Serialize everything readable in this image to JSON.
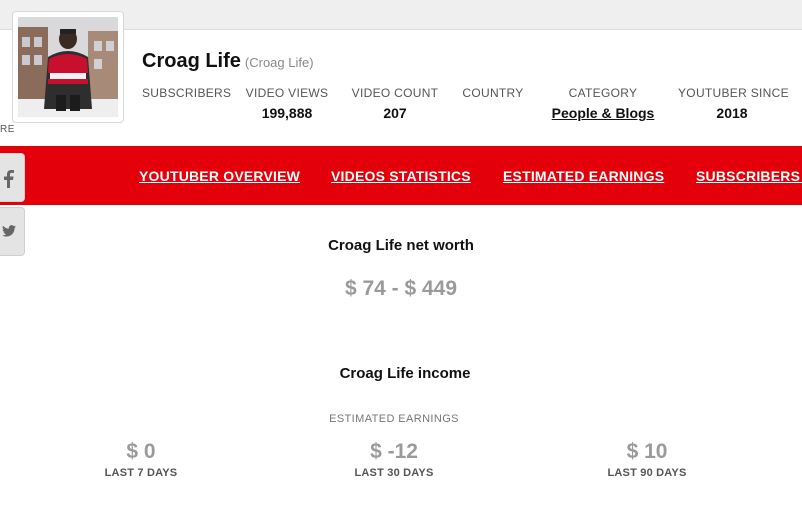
{
  "channel": {
    "name": "Croag Life",
    "handle": "(Croag Life)"
  },
  "share_label_fragment": "RE",
  "stats": [
    {
      "label": "SUBSCRIBERS",
      "value": ""
    },
    {
      "label": "VIDEO VIEWS",
      "value": "199,888"
    },
    {
      "label": "VIDEO COUNT",
      "value": "207"
    },
    {
      "label": "COUNTRY",
      "value": ""
    },
    {
      "label": "CATEGORY",
      "value": "People & Blogs"
    },
    {
      "label": "YOUTUBER SINCE",
      "value": "2018"
    }
  ],
  "nav": [
    {
      "label": "YOUTUBER OVERVIEW"
    },
    {
      "label": "VIDEOS STATISTICS"
    },
    {
      "label": "ESTIMATED EARNINGS"
    },
    {
      "label": "SUBSCRIBERS LIVE"
    }
  ],
  "social": [
    "facebook-icon",
    "twitter-icon"
  ],
  "net_worth": {
    "title": "Croag Life net worth",
    "value": "$ 74 - $ 449"
  },
  "income": {
    "title": "Croag Life income",
    "estimated_label": "ESTIMATED EARNINGS",
    "periods": [
      {
        "value": "$ 0",
        "label": "LAST 7 DAYS"
      },
      {
        "value": "$ -12",
        "label": "LAST 30 DAYS"
      },
      {
        "value": "$ 10",
        "label": "LAST 90 DAYS"
      }
    ]
  },
  "colors": {
    "nav_bg": "#e3000b",
    "muted_value": "#9a9a9a"
  }
}
